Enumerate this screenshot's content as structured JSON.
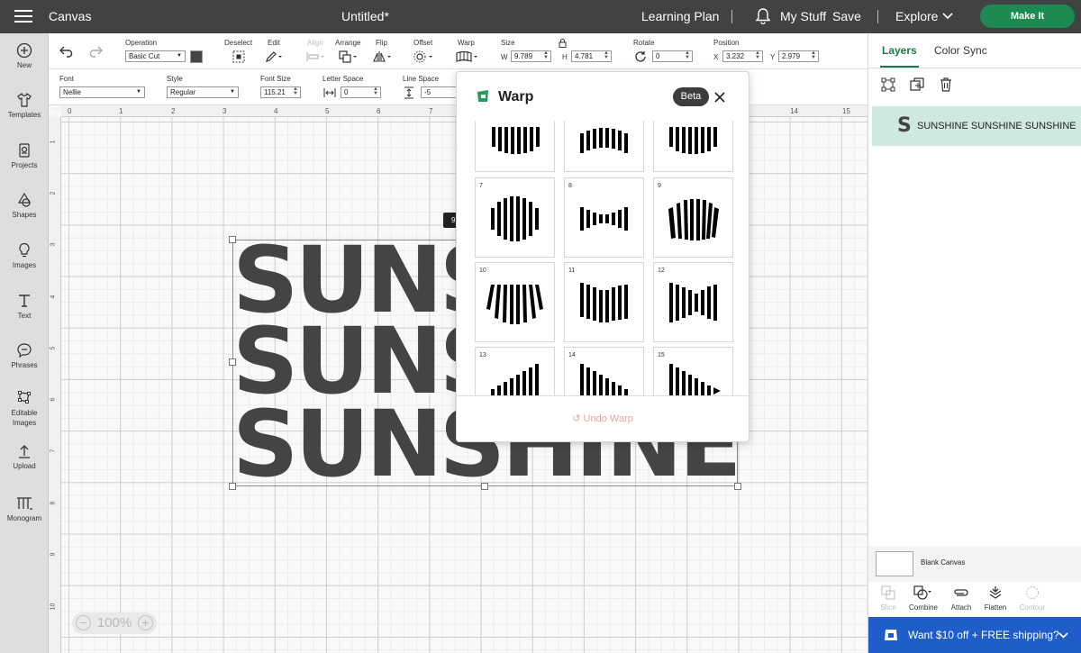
{
  "topbar": {
    "app": "Canvas",
    "doc_title": "Untitled*",
    "learning_plan": "Learning Plan",
    "my_stuff": "My Stuff",
    "save": "Save",
    "explore": "Explore",
    "make_it": "Make It"
  },
  "leftnav": [
    {
      "label": "New",
      "icon": "plus-circle-icon"
    },
    {
      "label": "Templates",
      "icon": "shirt-icon"
    },
    {
      "label": "Projects",
      "icon": "projects-icon"
    },
    {
      "label": "Shapes",
      "icon": "shapes-icon"
    },
    {
      "label": "Images",
      "icon": "lightbulb-icon"
    },
    {
      "label": "Text",
      "icon": "text-icon"
    },
    {
      "label": "Phrases",
      "icon": "speech-bubble-icon"
    },
    {
      "label": "Editable Images",
      "icon": "editable-images-icon"
    },
    {
      "label": "Upload",
      "icon": "upload-icon"
    },
    {
      "label": "Monogram",
      "icon": "monogram-icon"
    }
  ],
  "toolbar": {
    "operation_label": "Operation",
    "operation_value": "Basic Cut",
    "swatch_color": "#444444",
    "deselect": "Deselect",
    "edit": "Edit",
    "align": "Align",
    "arrange": "Arrange",
    "flip": "Flip",
    "offset": "Offset",
    "warp": "Warp",
    "size": "Size",
    "w_label": "W",
    "w_value": "9.789",
    "h_label": "H",
    "h_value": "4.781",
    "rotate": "Rotate",
    "rotate_value": "0",
    "position": "Position",
    "x_label": "X",
    "x_value": "3.232",
    "y_label": "Y",
    "y_value": "2.979"
  },
  "toolbar2": {
    "font_label": "Font",
    "font_value": "Nellie",
    "style_label": "Style",
    "style_value": "Regular",
    "font_size_label": "Font Size",
    "font_size_value": "115.21",
    "letter_space_label": "Letter Space",
    "letter_space_value": "0",
    "line_space_label": "Line Space",
    "line_space_value": "-5"
  },
  "rulers": {
    "top": [
      "0",
      "1",
      "2",
      "3",
      "4",
      "5",
      "6",
      "7",
      "14",
      "15"
    ],
    "left": [
      "1",
      "2",
      "3",
      "4",
      "5",
      "6",
      "7",
      "8",
      "9",
      "10"
    ]
  },
  "design": {
    "lines": [
      "SUNSHINE",
      "SUNSHINE",
      "SUNSHINE"
    ],
    "size_tag": "9"
  },
  "warp_panel": {
    "title": "Warp",
    "badge": "Beta",
    "undo": "Undo Warp",
    "tiles": [
      {
        "num": ""
      },
      {
        "num": ""
      },
      {
        "num": ""
      },
      {
        "num": "7"
      },
      {
        "num": "8"
      },
      {
        "num": "9"
      },
      {
        "num": "10"
      },
      {
        "num": "11"
      },
      {
        "num": "12"
      },
      {
        "num": "13"
      },
      {
        "num": "14"
      },
      {
        "num": "15"
      }
    ]
  },
  "rightpanel": {
    "tabs": [
      "Layers",
      "Color Sync"
    ],
    "layer_text": "SUNSHINE SUNSHINE SUNSHINE",
    "blank_canvas": "Blank Canvas",
    "tools": [
      {
        "label": "Slice",
        "enabled": false
      },
      {
        "label": "Combine",
        "enabled": true
      },
      {
        "label": "Attach",
        "enabled": true
      },
      {
        "label": "Flatten",
        "enabled": true
      },
      {
        "label": "Contour",
        "enabled": false
      }
    ],
    "promo": "Want $10 off + FREE shipping?"
  },
  "zoom": "100%"
}
